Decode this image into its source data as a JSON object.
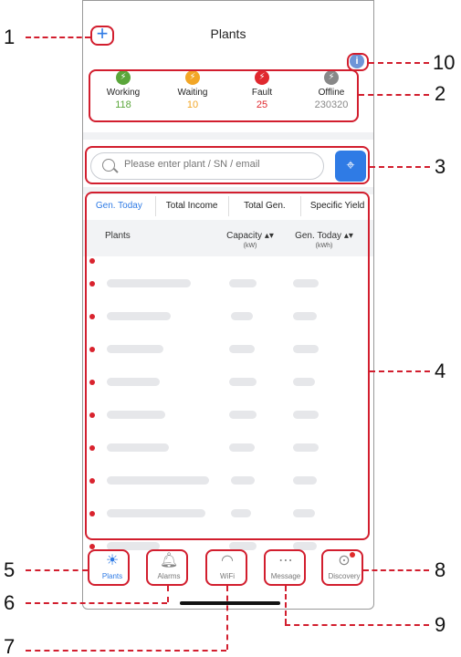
{
  "header": {
    "title": "Plants",
    "add_icon": "+",
    "info_icon": "i"
  },
  "status": [
    {
      "label": "Working",
      "count": "118",
      "color": "#5aa63a"
    },
    {
      "label": "Waiting",
      "count": "10",
      "color": "#f2a626"
    },
    {
      "label": "Fault",
      "count": "25",
      "color": "#e0282e"
    },
    {
      "label": "Offline",
      "count": "230320",
      "color": "#888888"
    }
  ],
  "search": {
    "placeholder": "Please enter plant / SN / email"
  },
  "tabs": [
    "Gen. Today",
    "Total Income",
    "Total Gen.",
    "Specific Yield"
  ],
  "table": {
    "col_plants": "Plants",
    "col_capacity": "Capacity",
    "col_capacity_unit": "(kW)",
    "col_gen_today": "Gen. Today",
    "col_gen_today_unit": "(kWh)"
  },
  "nav": [
    {
      "label": "Plants",
      "icon": "plants-icon"
    },
    {
      "label": "Alarms",
      "icon": "bell-icon"
    },
    {
      "label": "WiFi",
      "icon": "wifi-icon"
    },
    {
      "label": "Message",
      "icon": "message-icon"
    },
    {
      "label": "Discovery",
      "icon": "compass-icon"
    }
  ],
  "callouts": [
    "1",
    "2",
    "3",
    "4",
    "5",
    "6",
    "7",
    "8",
    "9",
    "10"
  ],
  "colors": {
    "accent": "#2f7be5",
    "callout": "#d21e2e",
    "fault": "#d9232e"
  }
}
